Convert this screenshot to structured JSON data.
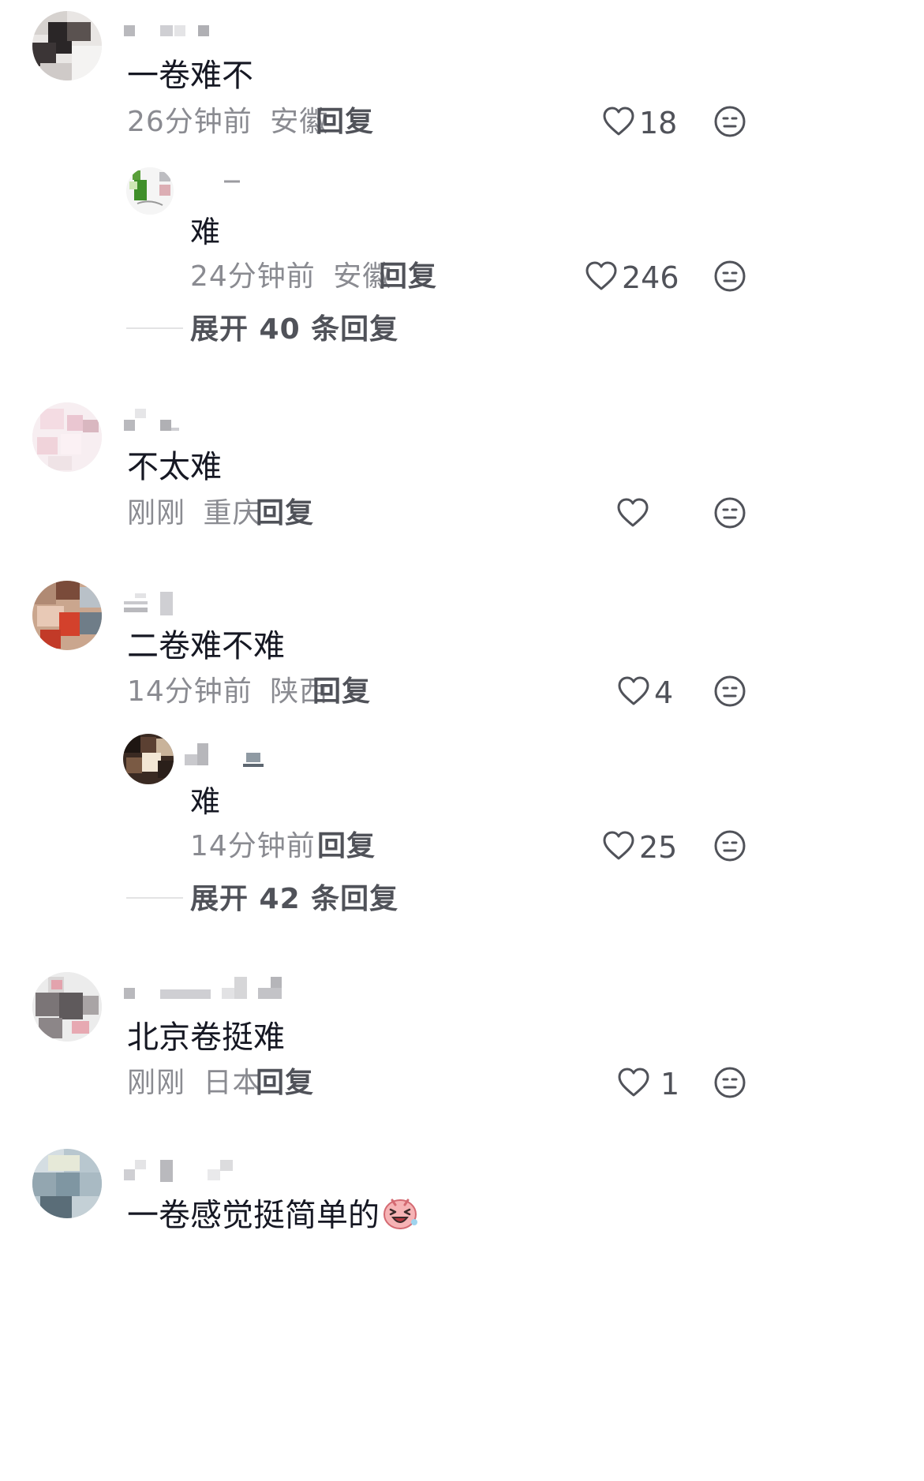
{
  "comments": [
    {
      "content": "一卷难不",
      "time": "26分钟前",
      "location": "安徽",
      "reply_label": "回复",
      "likes": "18",
      "replies": [
        {
          "content": "难",
          "time": "24分钟前",
          "location": "安徽",
          "reply_label": "回复",
          "likes": "246"
        }
      ],
      "expand_label": "展开 40 条回复"
    },
    {
      "content": "不太难",
      "time": "刚刚",
      "location": "重庆",
      "reply_label": "回复",
      "likes": ""
    },
    {
      "content": "二卷难不难",
      "time": "14分钟前",
      "location": "陕西",
      "reply_label": "回复",
      "likes": "4",
      "replies": [
        {
          "content": "难",
          "time": "14分钟前",
          "reply_label": "回复",
          "likes": "25"
        }
      ],
      "expand_label": "展开 42 条回复"
    },
    {
      "content": "北京卷挺难",
      "time": "刚刚",
      "location": "日本",
      "reply_label": "回复",
      "likes": "1"
    },
    {
      "content": "一卷感觉挺简单的",
      "emoji": "laughing-face-emoji"
    }
  ],
  "icons": {
    "like": "heart-outline-icon",
    "dislike": "neutral-face-icon"
  },
  "colors": {
    "text_primary": "#161823",
    "text_meta": "#8a8b91",
    "text_action": "#505259",
    "icon_stroke": "#505259"
  }
}
